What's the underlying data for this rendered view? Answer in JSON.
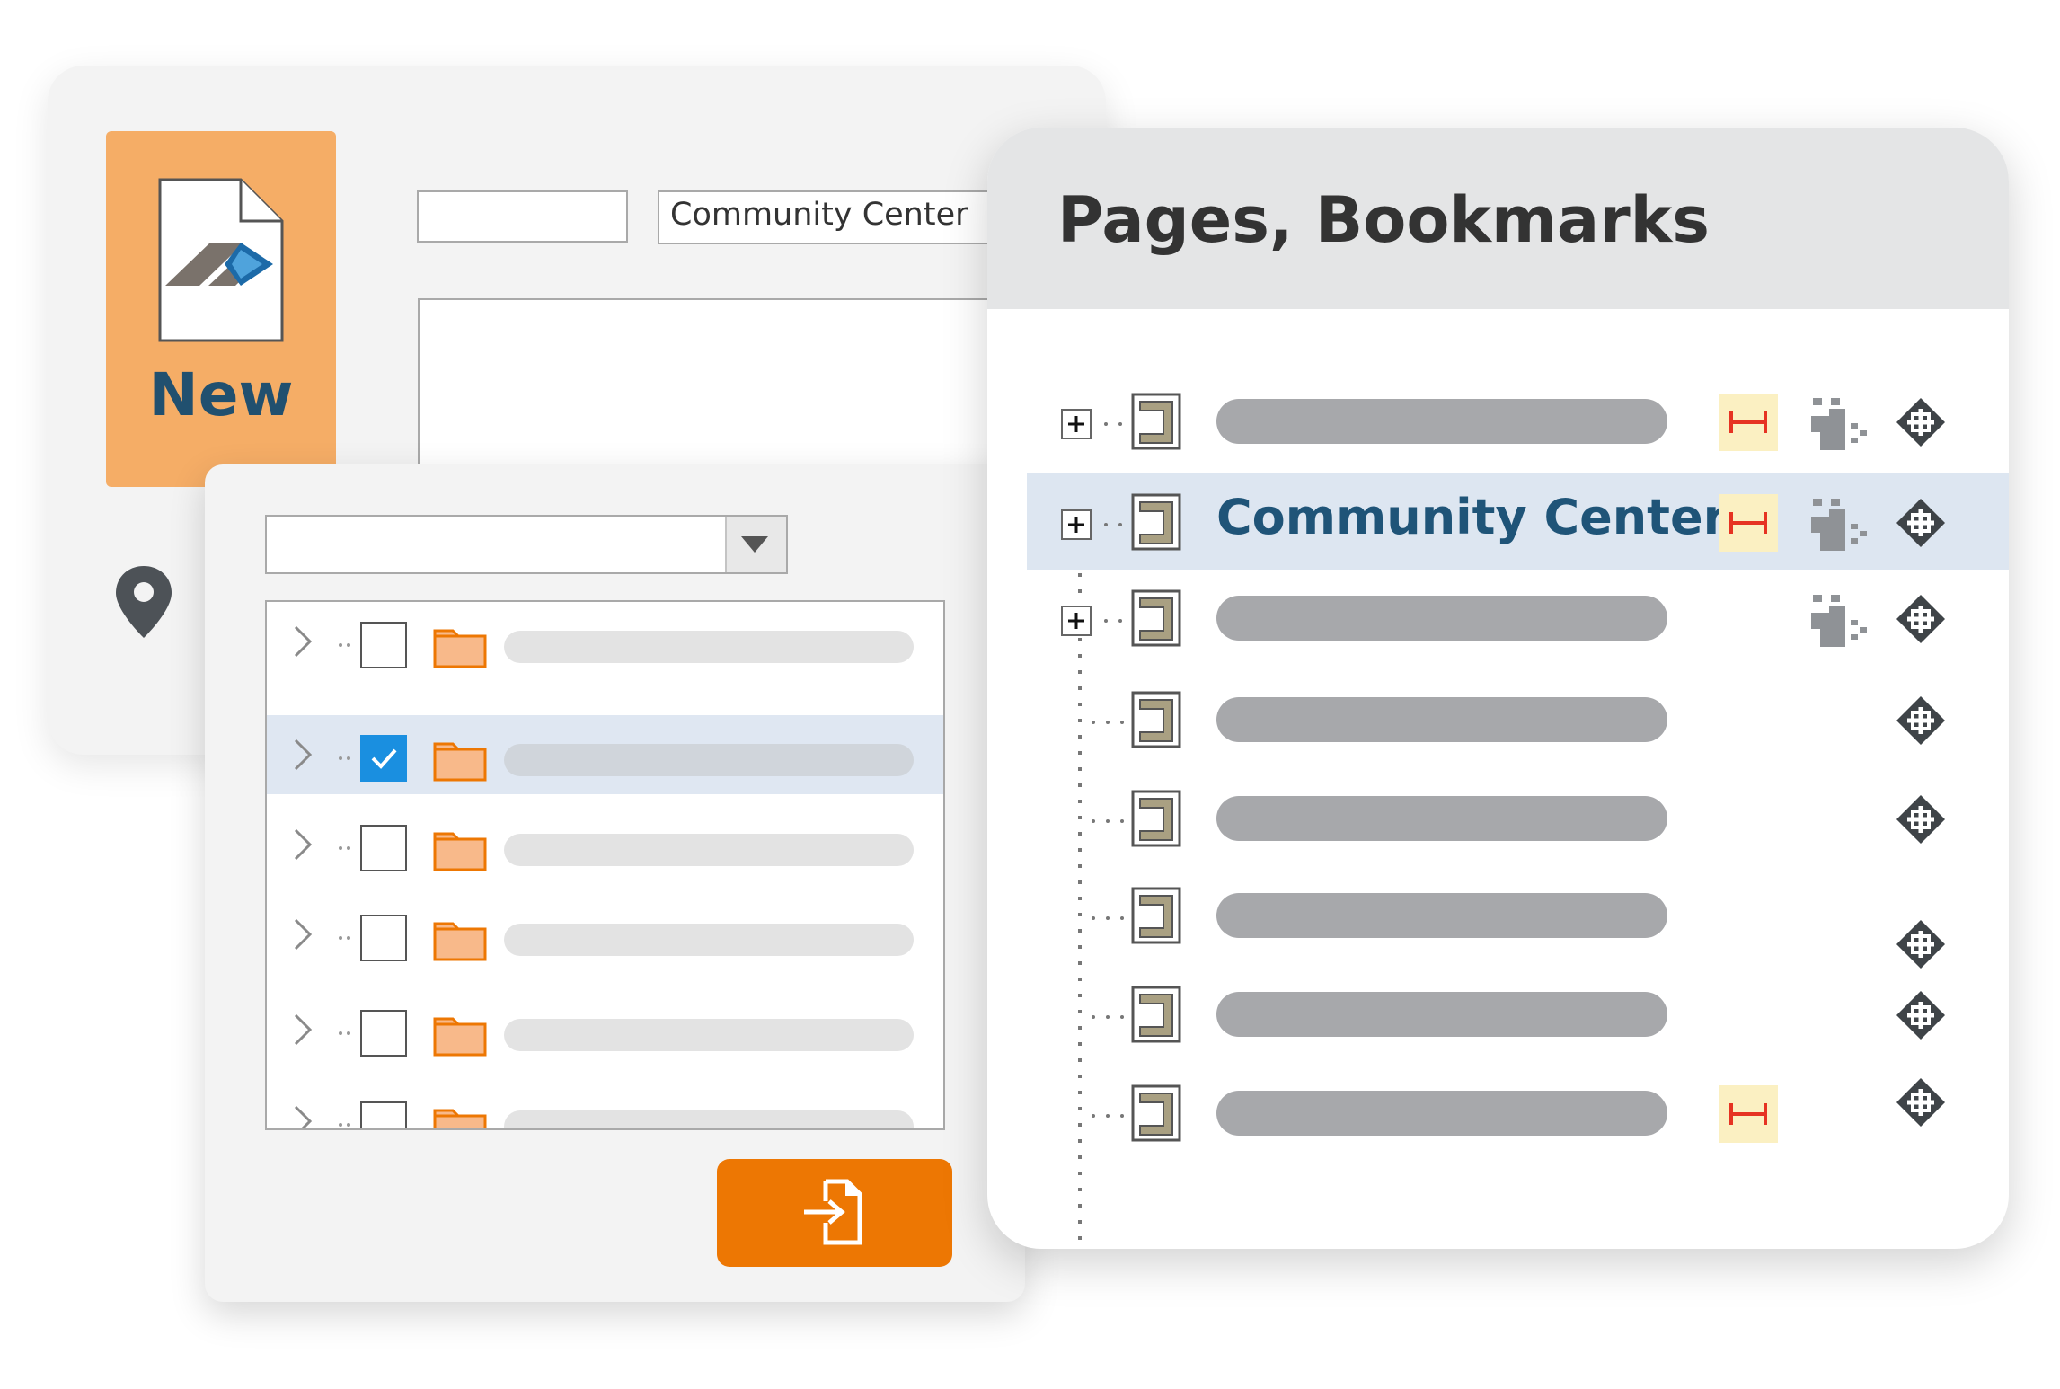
{
  "new_tile": {
    "label": "New"
  },
  "form": {
    "name_value": "Community Center"
  },
  "bookmarks": {
    "title": "Pages, Bookmarks",
    "selected_label": "Community Center"
  },
  "colors": {
    "accent_orange": "#ed7703",
    "tile_orange": "#f5ad66",
    "brand_blue": "#21506f",
    "selection_blue": "#dde6f1",
    "checkbox_blue": "#1a8fe0",
    "hyperlink_red": "#e63322",
    "hyperlink_bg": "#fbf0c2"
  }
}
